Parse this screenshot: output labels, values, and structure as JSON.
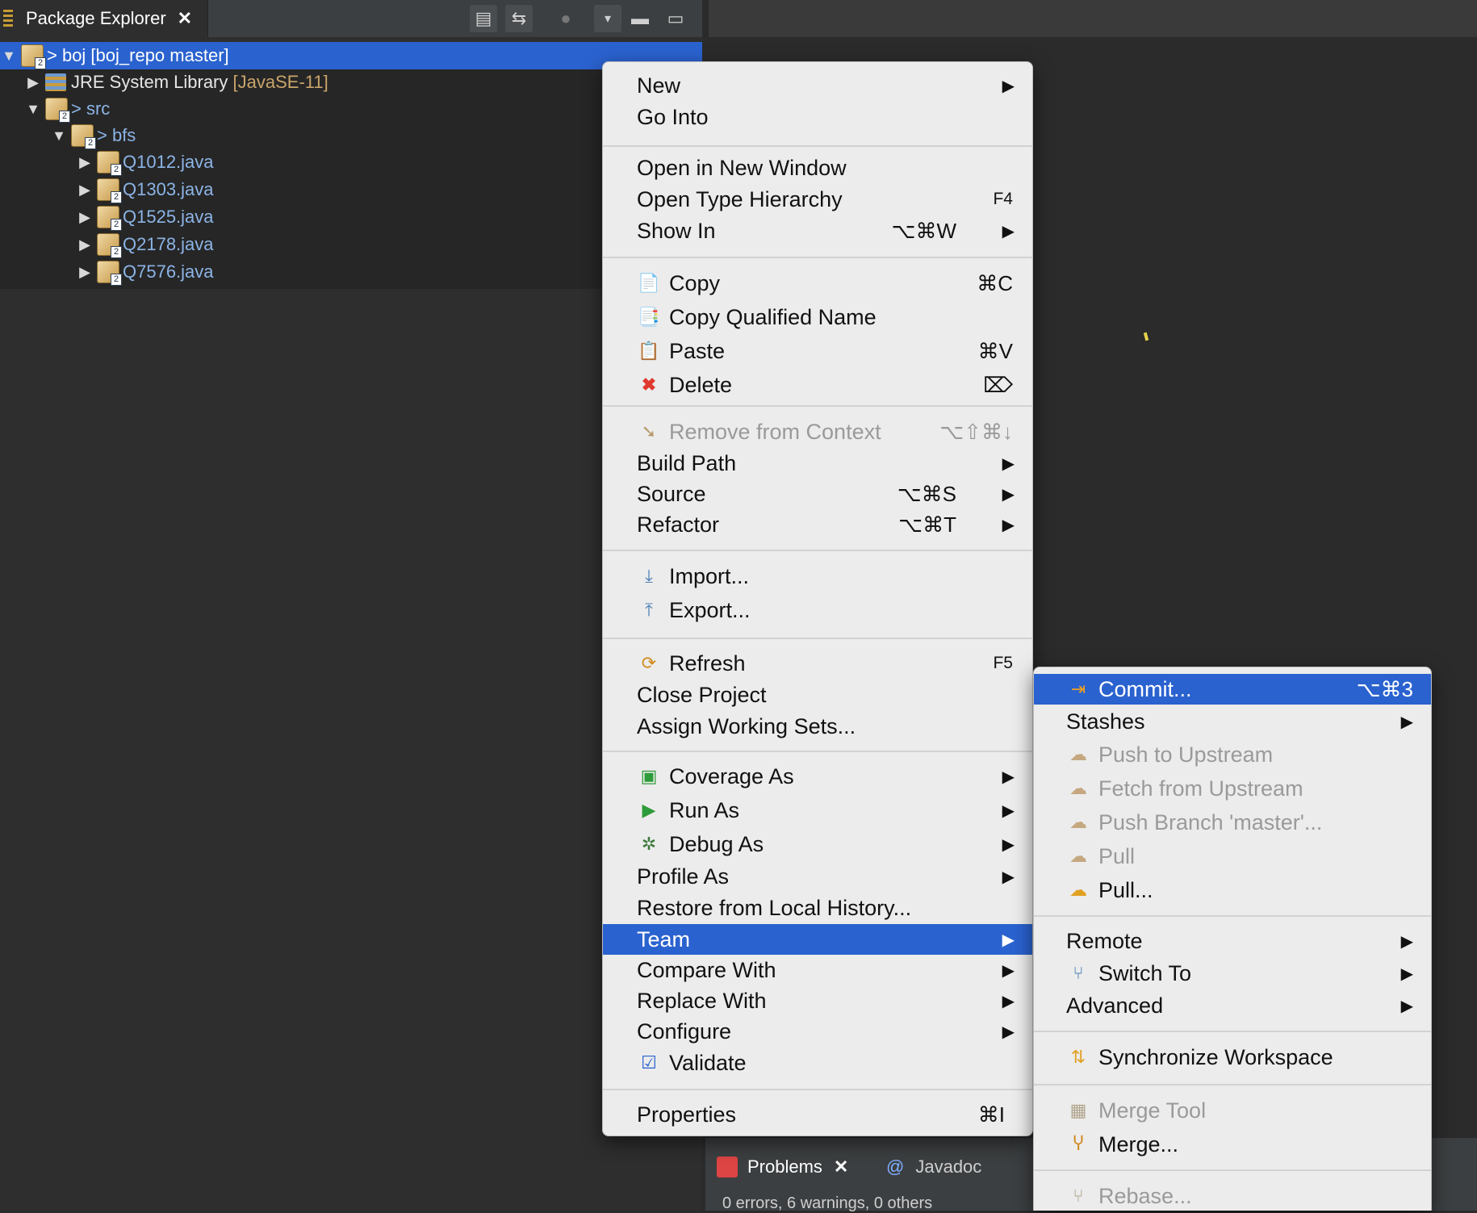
{
  "explorer": {
    "tab_label": "Package Explorer",
    "tree": [
      {
        "label": "> boj [boj_repo master]",
        "selected": true
      },
      {
        "label": "JRE System Library",
        "suffix": "[JavaSE-11]"
      },
      {
        "label": "> src"
      },
      {
        "label": "> bfs"
      },
      {
        "label": "Q1012.java"
      },
      {
        "label": "Q1303.java"
      },
      {
        "label": "Q1525.java"
      },
      {
        "label": "Q2178.java"
      },
      {
        "label": "Q7576.java"
      }
    ]
  },
  "context_menu": {
    "items": [
      {
        "label": "New"
      },
      {
        "label": "Go Into"
      },
      {
        "label": "Open in New Window"
      },
      {
        "label": "Open Type Hierarchy",
        "shortcut": "F4"
      },
      {
        "label": "Show In",
        "shortcut": "⌥⌘W"
      },
      {
        "label": "Copy",
        "shortcut": "⌘C",
        "icon": "copy-icon"
      },
      {
        "label": "Copy Qualified Name",
        "icon": "copy-qualified-name-icon"
      },
      {
        "label": "Paste",
        "shortcut": "⌘V",
        "icon": "paste-icon"
      },
      {
        "label": "Delete",
        "shortcut": "⌦",
        "icon": "delete-icon"
      },
      {
        "label": "Remove from Context",
        "shortcut": "⌥⇧⌘↓",
        "disabled": true
      },
      {
        "label": "Build Path"
      },
      {
        "label": "Source",
        "shortcut": "⌥⌘S"
      },
      {
        "label": "Refactor",
        "shortcut": "⌥⌘T"
      },
      {
        "label": "Import...",
        "icon": "import-icon"
      },
      {
        "label": "Export...",
        "icon": "export-icon"
      },
      {
        "label": "Refresh",
        "shortcut": "F5",
        "icon": "refresh-icon"
      },
      {
        "label": "Close Project"
      },
      {
        "label": "Assign Working Sets..."
      },
      {
        "label": "Coverage As",
        "icon": "coverage-icon"
      },
      {
        "label": "Run As",
        "icon": "run-icon"
      },
      {
        "label": "Debug As",
        "icon": "debug-icon"
      },
      {
        "label": "Profile As"
      },
      {
        "label": "Restore from Local History..."
      },
      {
        "label": "Team",
        "highlighted": true
      },
      {
        "label": "Compare With"
      },
      {
        "label": "Replace With"
      },
      {
        "label": "Configure"
      },
      {
        "label": "Validate",
        "icon": "checkbox-icon"
      },
      {
        "label": "Properties",
        "shortcut": "⌘I"
      }
    ]
  },
  "team_submenu": {
    "items": [
      {
        "label": "Commit...",
        "shortcut": "⌥⌘3",
        "highlighted": true
      },
      {
        "label": "Stashes"
      },
      {
        "label": "Push to Upstream",
        "disabled": true
      },
      {
        "label": "Fetch from Upstream",
        "disabled": true
      },
      {
        "label": "Push Branch 'master'...",
        "disabled": true
      },
      {
        "label": "Pull",
        "disabled": true
      },
      {
        "label": "Pull..."
      },
      {
        "label": "Remote"
      },
      {
        "label": "Switch To"
      },
      {
        "label": "Advanced"
      },
      {
        "label": "Synchronize Workspace"
      },
      {
        "label": "Merge Tool",
        "disabled": true
      },
      {
        "label": "Merge..."
      },
      {
        "label": "Rebase...",
        "disabled": true
      }
    ]
  },
  "bottom_panel": {
    "tabs": [
      {
        "label": "Problems"
      },
      {
        "label": "Javadoc"
      }
    ],
    "status": "0 errors, 6 warnings, 0 others"
  },
  "colors": {
    "selection": "#2a62cf",
    "menu_bg": "#ececec",
    "panel_bg": "#2e2e2e"
  }
}
